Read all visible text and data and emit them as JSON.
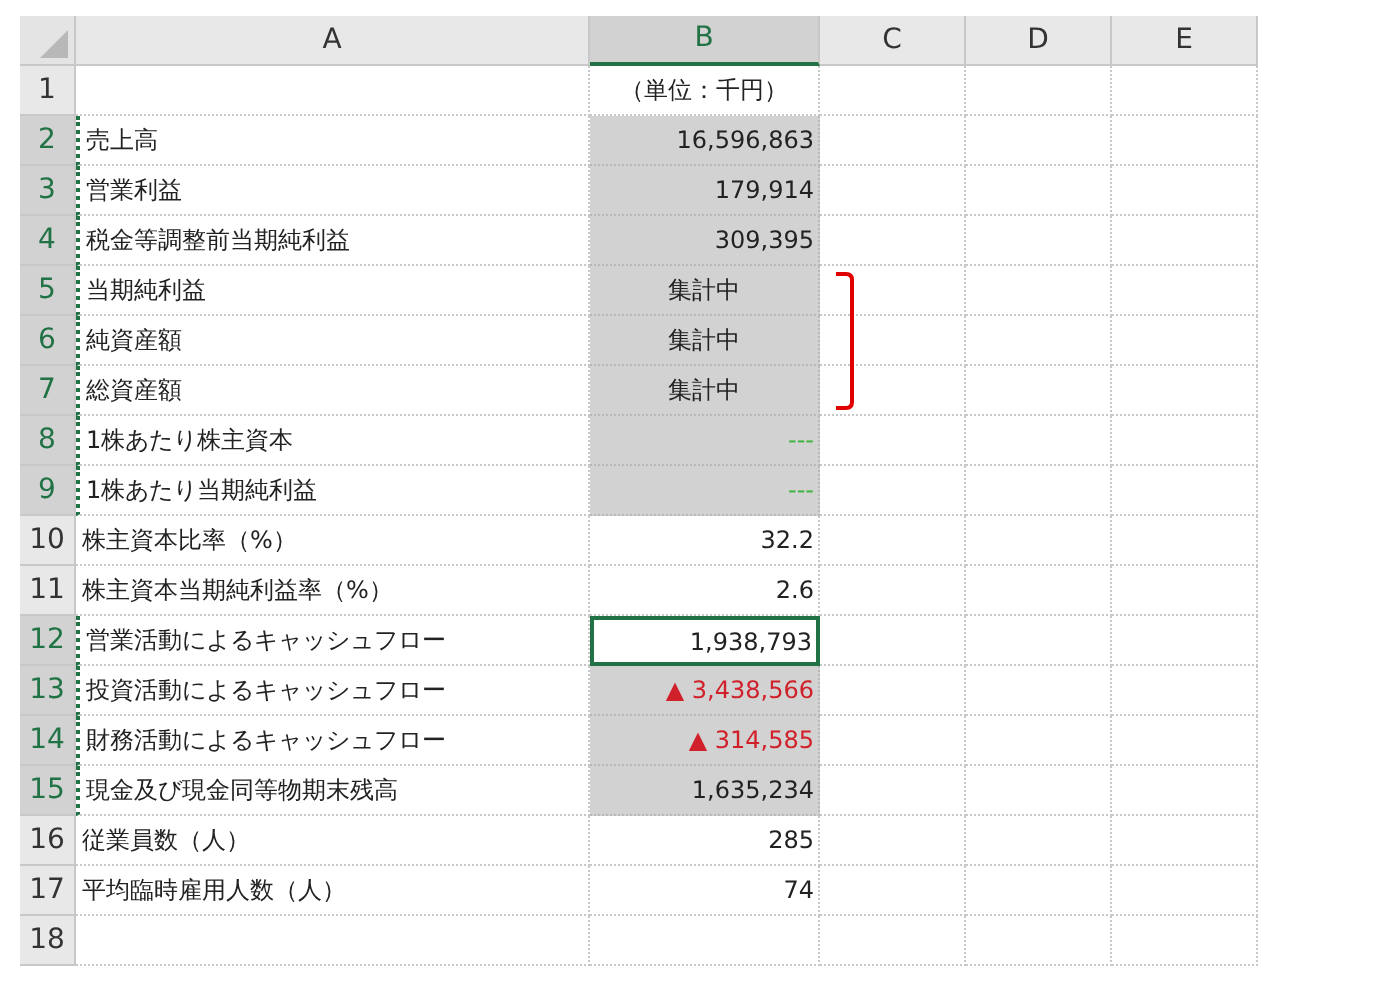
{
  "columns": [
    {
      "label": "A",
      "selected": false
    },
    {
      "label": "B",
      "selected": true
    },
    {
      "label": "C",
      "selected": false
    },
    {
      "label": "D",
      "selected": false
    },
    {
      "label": "E",
      "selected": false
    }
  ],
  "rows": [
    {
      "number": "1",
      "label": "",
      "value": "（単位：千円）",
      "kind": "center",
      "selected": false,
      "active": false,
      "bracketed": false
    },
    {
      "number": "2",
      "label": "売上高",
      "value": "16,596,863",
      "kind": "number",
      "selected": true,
      "active": false,
      "bracketed": false
    },
    {
      "number": "3",
      "label": "営業利益",
      "value": "179,914",
      "kind": "number",
      "selected": true,
      "active": false,
      "bracketed": false
    },
    {
      "number": "4",
      "label": "税金等調整前当期純利益",
      "value": "309,395",
      "kind": "number",
      "selected": true,
      "active": false,
      "bracketed": false
    },
    {
      "number": "5",
      "label": "当期純利益",
      "value": "集計中",
      "kind": "center",
      "selected": true,
      "active": false,
      "bracketed": true
    },
    {
      "number": "6",
      "label": "純資産額",
      "value": "集計中",
      "kind": "center",
      "selected": true,
      "active": false,
      "bracketed": true
    },
    {
      "number": "7",
      "label": "総資産額",
      "value": "集計中",
      "kind": "center",
      "selected": true,
      "active": false,
      "bracketed": true
    },
    {
      "number": "8",
      "label": "1株あたり株主資本",
      "value": "---",
      "kind": "na",
      "selected": true,
      "active": false,
      "bracketed": false
    },
    {
      "number": "9",
      "label": "1株あたり当期純利益",
      "value": "---",
      "kind": "na",
      "selected": true,
      "active": false,
      "bracketed": false
    },
    {
      "number": "10",
      "label": "株主資本比率（%）",
      "value": "32.2",
      "kind": "number",
      "selected": false,
      "active": false,
      "bracketed": false
    },
    {
      "number": "11",
      "label": "株主資本当期純利益率（%）",
      "value": "2.6",
      "kind": "number",
      "selected": false,
      "active": false,
      "bracketed": false
    },
    {
      "number": "12",
      "label": "営業活動によるキャッシュフロー",
      "value": "1,938,793",
      "kind": "number",
      "selected": true,
      "active": true,
      "bracketed": false
    },
    {
      "number": "13",
      "label": "投資活動によるキャッシュフロー",
      "value": "▲ 3,438,566",
      "kind": "negative",
      "selected": true,
      "active": false,
      "bracketed": false
    },
    {
      "number": "14",
      "label": "財務活動によるキャッシュフロー",
      "value": "▲ 314,585",
      "kind": "negative",
      "selected": true,
      "active": false,
      "bracketed": false
    },
    {
      "number": "15",
      "label": "現金及び現金同等物期末残高",
      "value": "1,635,234",
      "kind": "number",
      "selected": true,
      "active": false,
      "bracketed": false
    },
    {
      "number": "16",
      "label": "従業員数（人）",
      "value": "285",
      "kind": "number",
      "selected": false,
      "active": false,
      "bracketed": false
    },
    {
      "number": "17",
      "label": "平均臨時雇用人数（人）",
      "value": "74",
      "kind": "number",
      "selected": false,
      "active": false,
      "bracketed": false
    },
    {
      "number": "18",
      "label": "",
      "value": "",
      "kind": "number",
      "selected": false,
      "active": false,
      "bracketed": false
    }
  ]
}
